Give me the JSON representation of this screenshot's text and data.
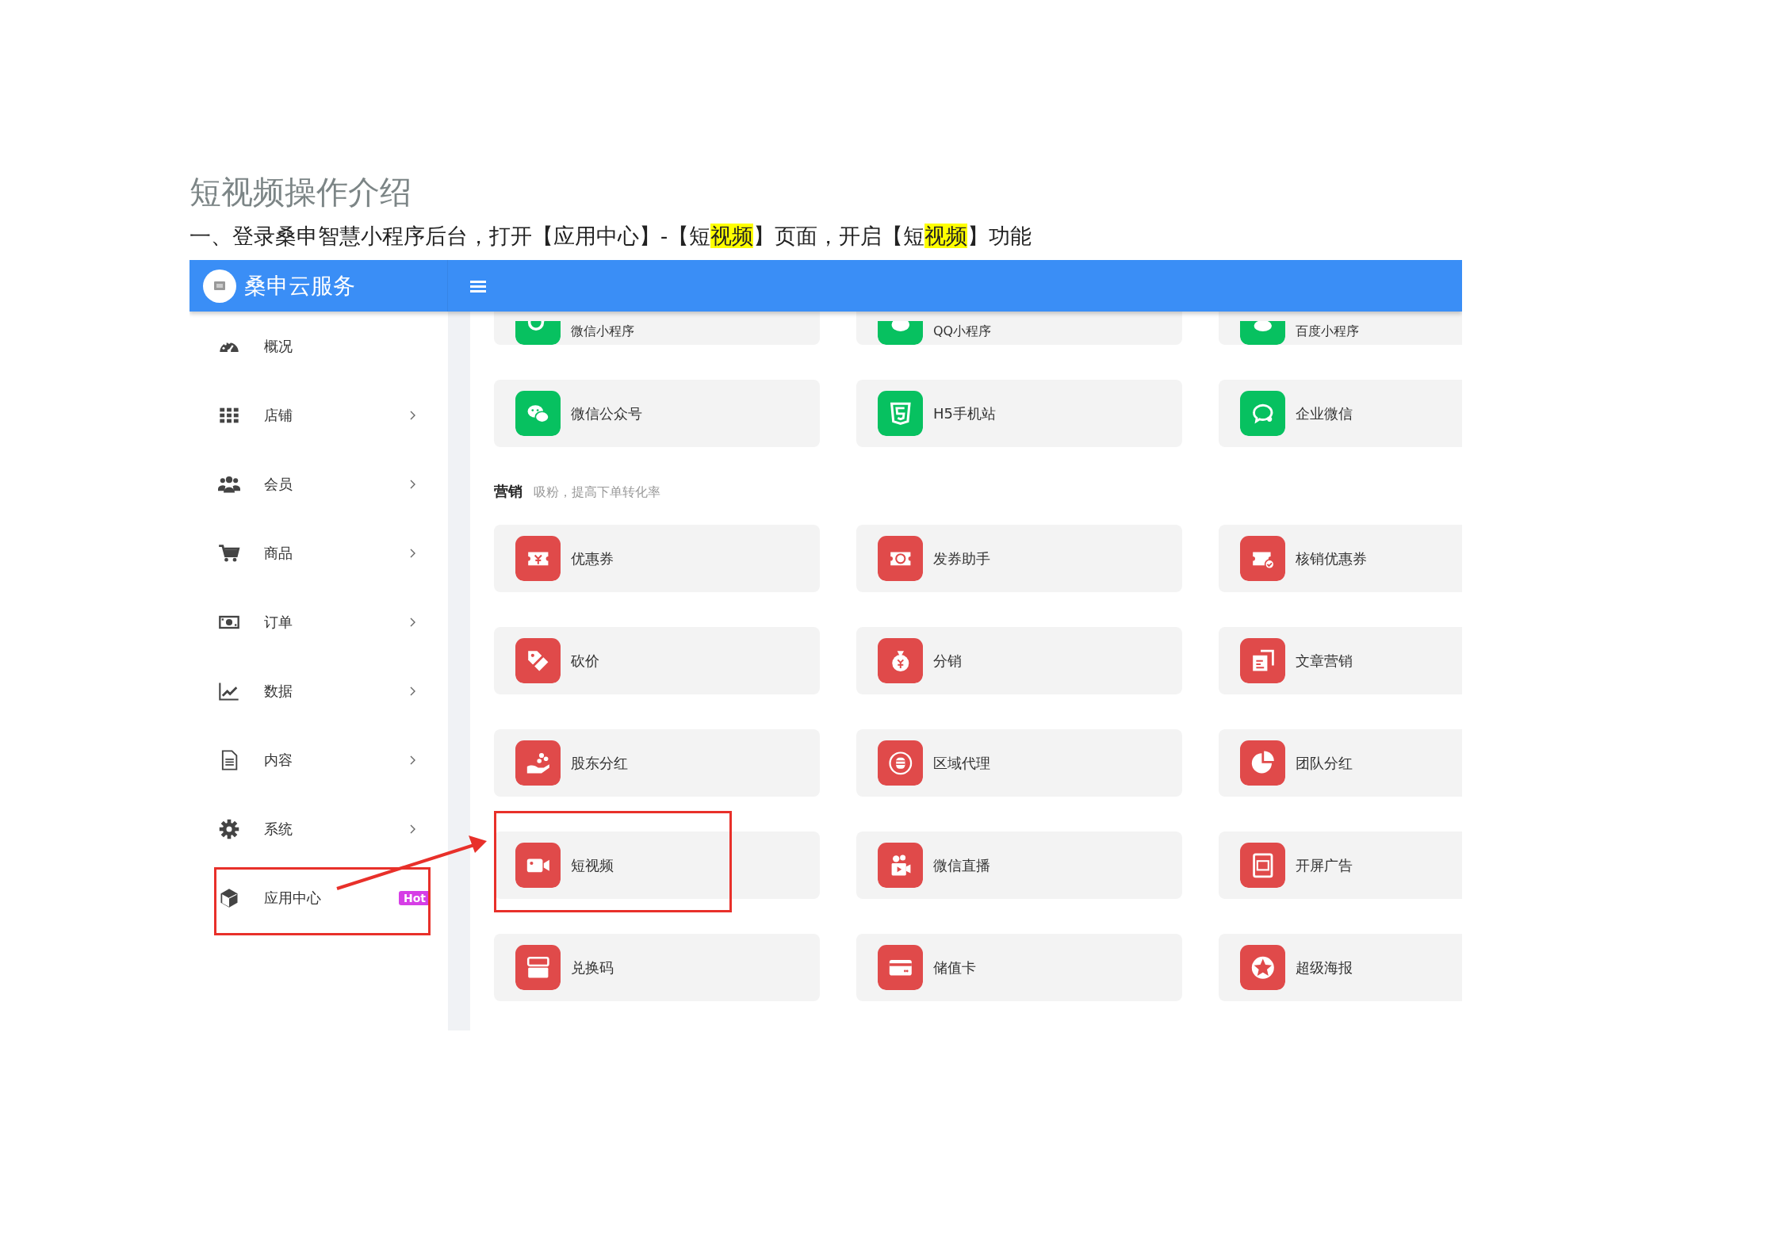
{
  "heading": "短视频操作介绍",
  "instruction": [
    {
      "text": "一、登录桑申智慧小程序后台，打开【应用中心】-【短",
      "highlighted": false
    },
    {
      "text": "视频",
      "highlighted": true
    },
    {
      "text": "】页面，开启【短",
      "highlighted": false
    },
    {
      "text": "视频",
      "highlighted": true
    },
    {
      "text": "】功能",
      "highlighted": false
    }
  ],
  "app": {
    "brand": "桑申云服务",
    "sidebar": {
      "items": [
        {
          "label": "概况",
          "has_submenu": false,
          "outlined": false
        },
        {
          "label": "店铺",
          "has_submenu": true,
          "outlined": false
        },
        {
          "label": "会员",
          "has_submenu": true,
          "outlined": false
        },
        {
          "label": "商品",
          "has_submenu": true,
          "outlined": false
        },
        {
          "label": "订单",
          "has_submenu": true,
          "outlined": false
        },
        {
          "label": "数据",
          "has_submenu": true,
          "outlined": false
        },
        {
          "label": "内容",
          "has_submenu": true,
          "outlined": false
        },
        {
          "label": "系统",
          "has_submenu": true,
          "outlined": false
        },
        {
          "label": "应用中心",
          "has_submenu": false,
          "outlined": true,
          "badge": "Hot"
        }
      ]
    },
    "sections": [
      {
        "kind": "channel",
        "cut_top": true,
        "cards": [
          {
            "label": "微信小程序",
            "outlined": false
          },
          {
            "label": "QQ小程序",
            "outlined": false
          },
          {
            "label": "百度小程序",
            "outlined": false
          },
          {
            "label": "微信公众号",
            "outlined": false
          },
          {
            "label": "H5手机站",
            "outlined": false
          },
          {
            "label": "企业微信",
            "outlined": false
          }
        ]
      },
      {
        "kind": "marketing",
        "title": "营销",
        "subtitle": "吸粉，提高下单转化率",
        "cut_top": false,
        "cards": [
          {
            "label": "优惠券",
            "outlined": false
          },
          {
            "label": "发券助手",
            "outlined": false
          },
          {
            "label": "核销优惠券",
            "outlined": false
          },
          {
            "label": "砍价",
            "outlined": false
          },
          {
            "label": "分销",
            "outlined": false
          },
          {
            "label": "文章营销",
            "outlined": false
          },
          {
            "label": "股东分红",
            "outlined": false
          },
          {
            "label": "区域代理",
            "outlined": false
          },
          {
            "label": "团队分红",
            "outlined": false
          },
          {
            "label": "短视频",
            "outlined": true
          },
          {
            "label": "微信直播",
            "outlined": false
          },
          {
            "label": "开屏广告",
            "outlined": false
          },
          {
            "label": "兑换码",
            "outlined": false
          },
          {
            "label": "储值卡",
            "outlined": false
          },
          {
            "label": "超级海报",
            "outlined": false
          }
        ]
      }
    ]
  }
}
